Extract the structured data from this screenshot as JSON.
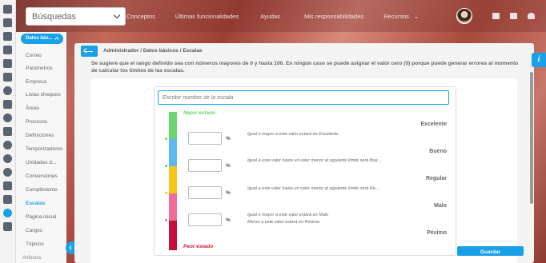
{
  "header": {
    "search_select": "Búsquedas",
    "nav": [
      "Conceptos",
      "Últimas funcionalidades",
      "Ayudas",
      "Mis responsabilidades",
      "Recursos"
    ]
  },
  "sidebar": {
    "module": "Datos bás...",
    "items": [
      "Correo",
      "Parámetros",
      "Empresa",
      "Listas chequeo",
      "Áreas",
      "Procesos",
      "Definiciones",
      "Temporizadores",
      "Unidades d...",
      "Conversiones",
      "Cumplimiento",
      "Escalas",
      "Página inicial",
      "Cargos",
      "Tópicos"
    ],
    "active_item": "Escalas",
    "attributes_select": "Atributos"
  },
  "breadcrumb": "Administrador / Datos básicos / Escalas",
  "notice": "Se sugiere que el rango definido sea con números mayores de 0 y hasta 100. En ningún caso se puede asignar el valor cero (0) porque puede generar errores al momento de calcular los límites de las escalas.",
  "scale": {
    "name_placeholder": "Escribir nombre de la escala",
    "best_label": "Mejor estado",
    "worst_label": "Peor estado",
    "levels": [
      {
        "name": "Excelente",
        "color": "#6ed36e"
      },
      {
        "name": "Bueno",
        "color": "#5bb8f0"
      },
      {
        "name": "Regular",
        "color": "#f5c518"
      },
      {
        "name": "Malo",
        "color": "#f06a9a"
      },
      {
        "name": "Pésimo",
        "color": "#c4103a"
      }
    ],
    "thresholds": [
      {
        "value": "",
        "unit": "%",
        "description": "Igual o mayor a este valor estará en Excelente"
      },
      {
        "value": "",
        "unit": "%",
        "description": "Igual a este valor hasta un valor menor al siguiente límite será Bue..."
      },
      {
        "value": "",
        "unit": "%",
        "description": "Igual a este valor hasta un valor menor al siguiente límite será Re..."
      },
      {
        "value": "",
        "unit": "%",
        "description": "Igual o mayor a este valor estará en Malo",
        "description2": "Menor a este valor estará en Pésimo"
      }
    ]
  },
  "actions": {
    "save": "Guardar",
    "info": "i"
  }
}
